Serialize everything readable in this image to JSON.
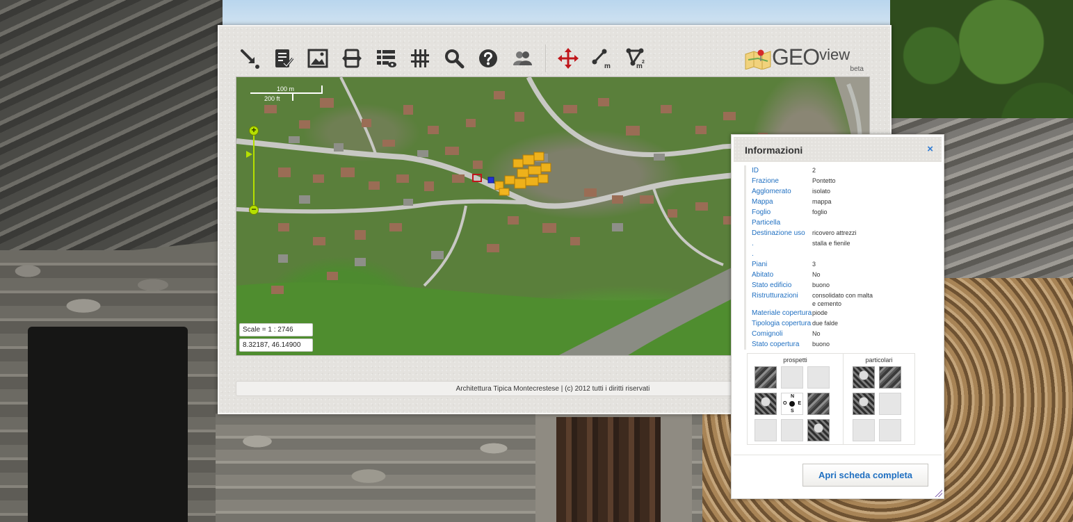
{
  "logo": {
    "brand": "GEO",
    "brand_suffix": "view",
    "tag": "beta"
  },
  "toolbar": {
    "tools": [
      {
        "name": "select-point-tool",
        "icon": "arrow-point-icon"
      },
      {
        "name": "checklist-tool",
        "icon": "checklist-icon"
      },
      {
        "name": "image-tool",
        "icon": "image-icon"
      },
      {
        "name": "fullscreen-tool",
        "icon": "expand-icon"
      },
      {
        "name": "layers-list-tool",
        "icon": "list-eye-icon"
      },
      {
        "name": "grid-tool",
        "icon": "grid-icon"
      },
      {
        "name": "search-tool",
        "icon": "search-icon"
      },
      {
        "name": "help-tool",
        "icon": "help-icon"
      },
      {
        "name": "users-tool",
        "icon": "users-icon"
      },
      {
        "name": "pan-tool",
        "icon": "move-arrows-icon"
      },
      {
        "name": "measure-distance-tool",
        "icon": "measure-line-icon",
        "unit": "m"
      },
      {
        "name": "measure-area-tool",
        "icon": "measure-area-icon",
        "unit": "m",
        "unit_sup": "2"
      }
    ]
  },
  "map": {
    "scale_top": "100 m",
    "scale_bottom": "200 ft",
    "scale_text": "Scale = 1 : 2746",
    "coords_text": "8.32187, 46.14900",
    "zoom_in": "+",
    "zoom_out": "−",
    "colors": {
      "selection": "#f5b417",
      "highlight_red": "#c0161b",
      "highlight_blue": "#2130d8"
    }
  },
  "footer": {
    "text": "Architettura Tipica Montecrestese | (c) 2012 tutti i diritti riservati"
  },
  "info": {
    "title": "Informazioni",
    "close": "×",
    "attributes": [
      {
        "key": "ID",
        "value": "2"
      },
      {
        "key": "Frazione",
        "value": "Pontetto"
      },
      {
        "key": "Agglomerato",
        "value": "isolato"
      },
      {
        "key": "Mappa",
        "value": "mappa"
      },
      {
        "key": "Foglio",
        "value": "foglio"
      },
      {
        "key": "Particella",
        "value": ""
      },
      {
        "key": "Destinazione uso",
        "value": "ricovero attrezzi"
      },
      {
        "key": ".",
        "value": "stalla e fienile"
      },
      {
        "key": ".",
        "value": ""
      },
      {
        "key": "Piani",
        "value": "3"
      },
      {
        "key": "Abitato",
        "value": "No"
      },
      {
        "key": "Stato edificio",
        "value": "buono"
      },
      {
        "key": "Ristrutturazioni",
        "value": "consolidato con malta e cemento"
      },
      {
        "key": "Materiale copertura",
        "value": "piode"
      },
      {
        "key": "Tipologia copertura",
        "value": "due falde"
      },
      {
        "key": "Comignoli",
        "value": "No"
      },
      {
        "key": "Stato copertura",
        "value": "buono"
      }
    ],
    "gallery": {
      "left_title": "prospetti",
      "right_title": "particolari",
      "compass": {
        "n": "N",
        "s": "S",
        "o": "O",
        "e": "E"
      }
    },
    "open_button": "Apri scheda completa"
  }
}
